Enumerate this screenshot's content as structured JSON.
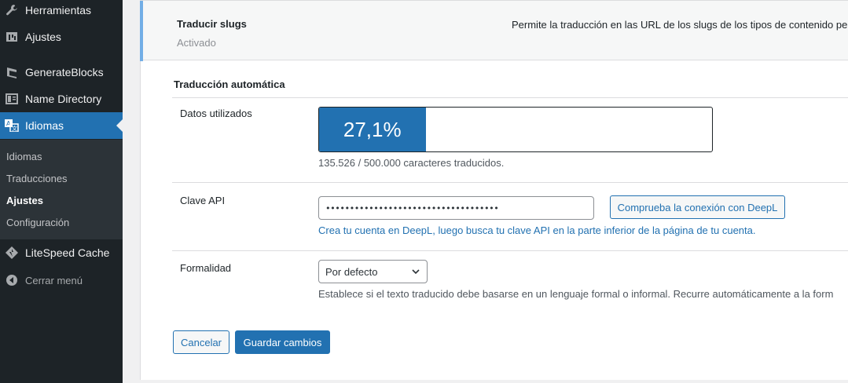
{
  "sidebar": {
    "menu": [
      {
        "label": "Herramientas",
        "icon": "wrench-icon"
      },
      {
        "label": "Ajustes",
        "icon": "settings-icon"
      },
      {
        "label": "GenerateBlocks",
        "icon": "generateblocks-icon"
      },
      {
        "label": "Name Directory",
        "icon": "directory-icon"
      },
      {
        "label": "Idiomas",
        "icon": "translate-icon",
        "current": true
      },
      {
        "label": "LiteSpeed Cache",
        "icon": "litespeed-icon"
      }
    ],
    "submenu": [
      {
        "label": "Idiomas"
      },
      {
        "label": "Traducciones"
      },
      {
        "label": "Ajustes",
        "active": true
      },
      {
        "label": "Configuración"
      }
    ],
    "collapse_label": "Cerrar menú"
  },
  "slugs": {
    "title": "Traducir slugs",
    "status": "Activado",
    "description": "Permite la traducción en las URL de los slugs de los tipos de contenido pers"
  },
  "auto_translation": {
    "heading": "Traducción automática",
    "usage": {
      "label": "Datos utilizados",
      "percent_text": "27,1%",
      "percent_value": 27.1,
      "detail": "135.526 / 500.000 caracteres traducidos."
    },
    "api_key": {
      "label": "Clave API",
      "value": "••••••••••••••••••••••••••••••••••••",
      "check_button": "Comprueba la conexión con DeepL",
      "help_link": "Crea tu cuenta en DeepL, luego busca tu clave API en la parte inferior de la página de tu cuenta."
    },
    "formality": {
      "label": "Formalidad",
      "selected": "Por defecto",
      "description": "Establece si el texto traducido debe basarse en un lenguaje formal o informal. Recurre automáticamente a la form"
    }
  },
  "actions": {
    "cancel": "Cancelar",
    "save": "Guardar cambios"
  },
  "colors": {
    "accent": "#2271b1",
    "sidebar_bg": "#1d2327",
    "submenu_bg": "#2c3338"
  }
}
